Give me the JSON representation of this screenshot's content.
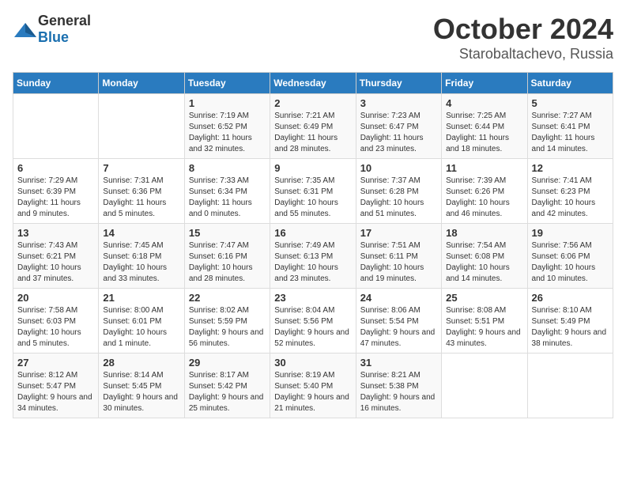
{
  "logo": {
    "general": "General",
    "blue": "Blue"
  },
  "title": "October 2024",
  "location": "Starobaltachevo, Russia",
  "weekdays": [
    "Sunday",
    "Monday",
    "Tuesday",
    "Wednesday",
    "Thursday",
    "Friday",
    "Saturday"
  ],
  "weeks": [
    [
      {
        "day": "",
        "sunrise": "",
        "sunset": "",
        "daylight": ""
      },
      {
        "day": "",
        "sunrise": "",
        "sunset": "",
        "daylight": ""
      },
      {
        "day": "1",
        "sunrise": "Sunrise: 7:19 AM",
        "sunset": "Sunset: 6:52 PM",
        "daylight": "Daylight: 11 hours and 32 minutes."
      },
      {
        "day": "2",
        "sunrise": "Sunrise: 7:21 AM",
        "sunset": "Sunset: 6:49 PM",
        "daylight": "Daylight: 11 hours and 28 minutes."
      },
      {
        "day": "3",
        "sunrise": "Sunrise: 7:23 AM",
        "sunset": "Sunset: 6:47 PM",
        "daylight": "Daylight: 11 hours and 23 minutes."
      },
      {
        "day": "4",
        "sunrise": "Sunrise: 7:25 AM",
        "sunset": "Sunset: 6:44 PM",
        "daylight": "Daylight: 11 hours and 18 minutes."
      },
      {
        "day": "5",
        "sunrise": "Sunrise: 7:27 AM",
        "sunset": "Sunset: 6:41 PM",
        "daylight": "Daylight: 11 hours and 14 minutes."
      }
    ],
    [
      {
        "day": "6",
        "sunrise": "Sunrise: 7:29 AM",
        "sunset": "Sunset: 6:39 PM",
        "daylight": "Daylight: 11 hours and 9 minutes."
      },
      {
        "day": "7",
        "sunrise": "Sunrise: 7:31 AM",
        "sunset": "Sunset: 6:36 PM",
        "daylight": "Daylight: 11 hours and 5 minutes."
      },
      {
        "day": "8",
        "sunrise": "Sunrise: 7:33 AM",
        "sunset": "Sunset: 6:34 PM",
        "daylight": "Daylight: 11 hours and 0 minutes."
      },
      {
        "day": "9",
        "sunrise": "Sunrise: 7:35 AM",
        "sunset": "Sunset: 6:31 PM",
        "daylight": "Daylight: 10 hours and 55 minutes."
      },
      {
        "day": "10",
        "sunrise": "Sunrise: 7:37 AM",
        "sunset": "Sunset: 6:28 PM",
        "daylight": "Daylight: 10 hours and 51 minutes."
      },
      {
        "day": "11",
        "sunrise": "Sunrise: 7:39 AM",
        "sunset": "Sunset: 6:26 PM",
        "daylight": "Daylight: 10 hours and 46 minutes."
      },
      {
        "day": "12",
        "sunrise": "Sunrise: 7:41 AM",
        "sunset": "Sunset: 6:23 PM",
        "daylight": "Daylight: 10 hours and 42 minutes."
      }
    ],
    [
      {
        "day": "13",
        "sunrise": "Sunrise: 7:43 AM",
        "sunset": "Sunset: 6:21 PM",
        "daylight": "Daylight: 10 hours and 37 minutes."
      },
      {
        "day": "14",
        "sunrise": "Sunrise: 7:45 AM",
        "sunset": "Sunset: 6:18 PM",
        "daylight": "Daylight: 10 hours and 33 minutes."
      },
      {
        "day": "15",
        "sunrise": "Sunrise: 7:47 AM",
        "sunset": "Sunset: 6:16 PM",
        "daylight": "Daylight: 10 hours and 28 minutes."
      },
      {
        "day": "16",
        "sunrise": "Sunrise: 7:49 AM",
        "sunset": "Sunset: 6:13 PM",
        "daylight": "Daylight: 10 hours and 23 minutes."
      },
      {
        "day": "17",
        "sunrise": "Sunrise: 7:51 AM",
        "sunset": "Sunset: 6:11 PM",
        "daylight": "Daylight: 10 hours and 19 minutes."
      },
      {
        "day": "18",
        "sunrise": "Sunrise: 7:54 AM",
        "sunset": "Sunset: 6:08 PM",
        "daylight": "Daylight: 10 hours and 14 minutes."
      },
      {
        "day": "19",
        "sunrise": "Sunrise: 7:56 AM",
        "sunset": "Sunset: 6:06 PM",
        "daylight": "Daylight: 10 hours and 10 minutes."
      }
    ],
    [
      {
        "day": "20",
        "sunrise": "Sunrise: 7:58 AM",
        "sunset": "Sunset: 6:03 PM",
        "daylight": "Daylight: 10 hours and 5 minutes."
      },
      {
        "day": "21",
        "sunrise": "Sunrise: 8:00 AM",
        "sunset": "Sunset: 6:01 PM",
        "daylight": "Daylight: 10 hours and 1 minute."
      },
      {
        "day": "22",
        "sunrise": "Sunrise: 8:02 AM",
        "sunset": "Sunset: 5:59 PM",
        "daylight": "Daylight: 9 hours and 56 minutes."
      },
      {
        "day": "23",
        "sunrise": "Sunrise: 8:04 AM",
        "sunset": "Sunset: 5:56 PM",
        "daylight": "Daylight: 9 hours and 52 minutes."
      },
      {
        "day": "24",
        "sunrise": "Sunrise: 8:06 AM",
        "sunset": "Sunset: 5:54 PM",
        "daylight": "Daylight: 9 hours and 47 minutes."
      },
      {
        "day": "25",
        "sunrise": "Sunrise: 8:08 AM",
        "sunset": "Sunset: 5:51 PM",
        "daylight": "Daylight: 9 hours and 43 minutes."
      },
      {
        "day": "26",
        "sunrise": "Sunrise: 8:10 AM",
        "sunset": "Sunset: 5:49 PM",
        "daylight": "Daylight: 9 hours and 38 minutes."
      }
    ],
    [
      {
        "day": "27",
        "sunrise": "Sunrise: 8:12 AM",
        "sunset": "Sunset: 5:47 PM",
        "daylight": "Daylight: 9 hours and 34 minutes."
      },
      {
        "day": "28",
        "sunrise": "Sunrise: 8:14 AM",
        "sunset": "Sunset: 5:45 PM",
        "daylight": "Daylight: 9 hours and 30 minutes."
      },
      {
        "day": "29",
        "sunrise": "Sunrise: 8:17 AM",
        "sunset": "Sunset: 5:42 PM",
        "daylight": "Daylight: 9 hours and 25 minutes."
      },
      {
        "day": "30",
        "sunrise": "Sunrise: 8:19 AM",
        "sunset": "Sunset: 5:40 PM",
        "daylight": "Daylight: 9 hours and 21 minutes."
      },
      {
        "day": "31",
        "sunrise": "Sunrise: 8:21 AM",
        "sunset": "Sunset: 5:38 PM",
        "daylight": "Daylight: 9 hours and 16 minutes."
      },
      {
        "day": "",
        "sunrise": "",
        "sunset": "",
        "daylight": ""
      },
      {
        "day": "",
        "sunrise": "",
        "sunset": "",
        "daylight": ""
      }
    ]
  ]
}
